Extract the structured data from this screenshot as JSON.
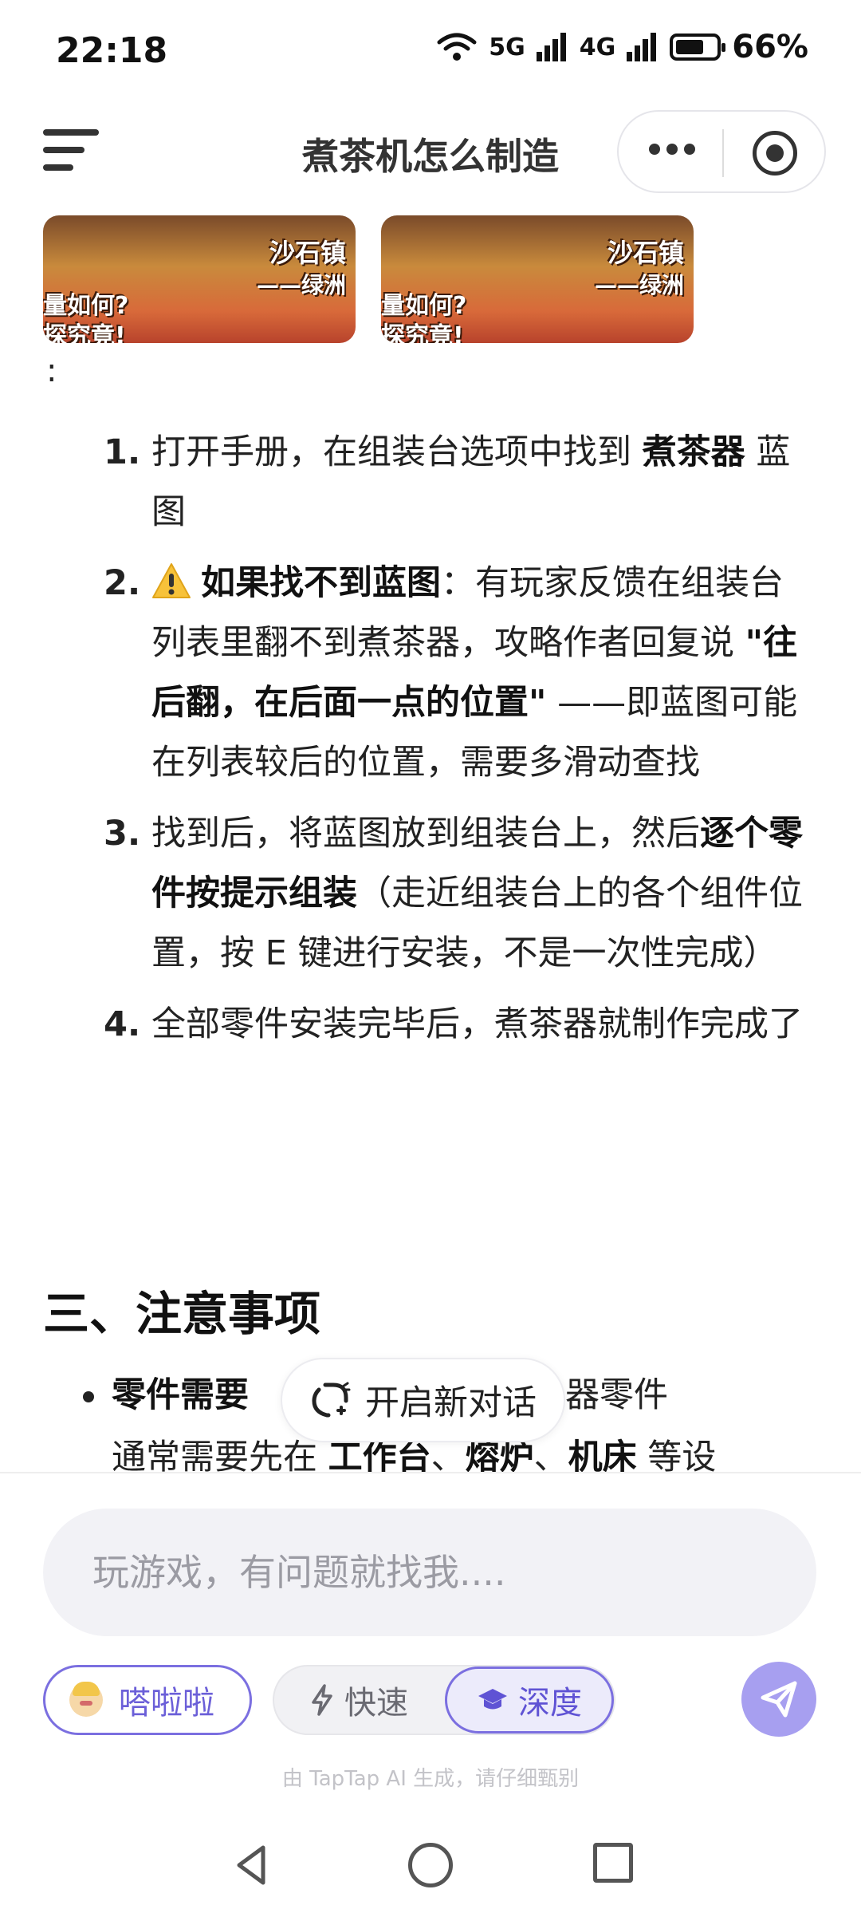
{
  "status_bar": {
    "time": "22:18",
    "network_5g": "5G",
    "network_4g": "4G",
    "battery_percent": "66%",
    "battery_level": 0.66
  },
  "header": {
    "title": "煮茶机怎么制造",
    "menu_icon": "hamburger-menu-icon",
    "more_icon": "more-dots-icon",
    "close_icon": "target-circle-icon"
  },
  "thumbnails": [
    {
      "line1": "沙石镇",
      "line2": "——绿洲",
      "line3": "量如何?",
      "line4": "探究竟!"
    },
    {
      "line1": "沙石镇",
      "line2": "——绿洲",
      "line3": "量如何?",
      "line4": "探究竟!"
    }
  ],
  "colon": ":",
  "steps": [
    {
      "num": "1.",
      "pre": "打开手册，在组装台选项中找到 ",
      "bold": "煮茶器",
      "post": " 蓝图"
    },
    {
      "num": "2.",
      "bold": "如果找不到蓝图",
      "mid": "：有玩家反馈在组装台列表里翻不到煮茶器，攻略作者回复说 ",
      "bold2": "\"往后翻，在后面一点的位置\"",
      "post": " ——即蓝图可能在列表较后的位置，需要多滑动查找"
    },
    {
      "num": "3.",
      "pre": "找到后，将蓝图放到组装台上，然后",
      "bold": "逐个零件按提示组装",
      "post": "（走近组装台上的各个组件位置，按 E 键进行安装，不是一次性完成）"
    },
    {
      "num": "4.",
      "pre": "全部零件安装完毕后，煮茶器就制作完成了"
    }
  ],
  "section_heading": "三、注意事项",
  "bullet": {
    "bold": "零件需要",
    "text1": "中的机器零件",
    "text2": "通常需要先在 ",
    "bold2": "工作台",
    "sep1": "、",
    "bold3": "熔炉",
    "sep2": "、",
    "bold4": "机床",
    "text3": " 等设"
  },
  "new_chat_button": "开启新对话",
  "input": {
    "placeholder": "玩游戏，有问题就找我...."
  },
  "character_chip": "嗒啦啦",
  "modes": {
    "fast": "快速",
    "deep": "深度",
    "selected": "深度"
  },
  "disclaimer": "由 TapTap AI 生成，请仔细甄别",
  "colors": {
    "accent": "#7b6fe0",
    "send": "#a79ff0"
  }
}
